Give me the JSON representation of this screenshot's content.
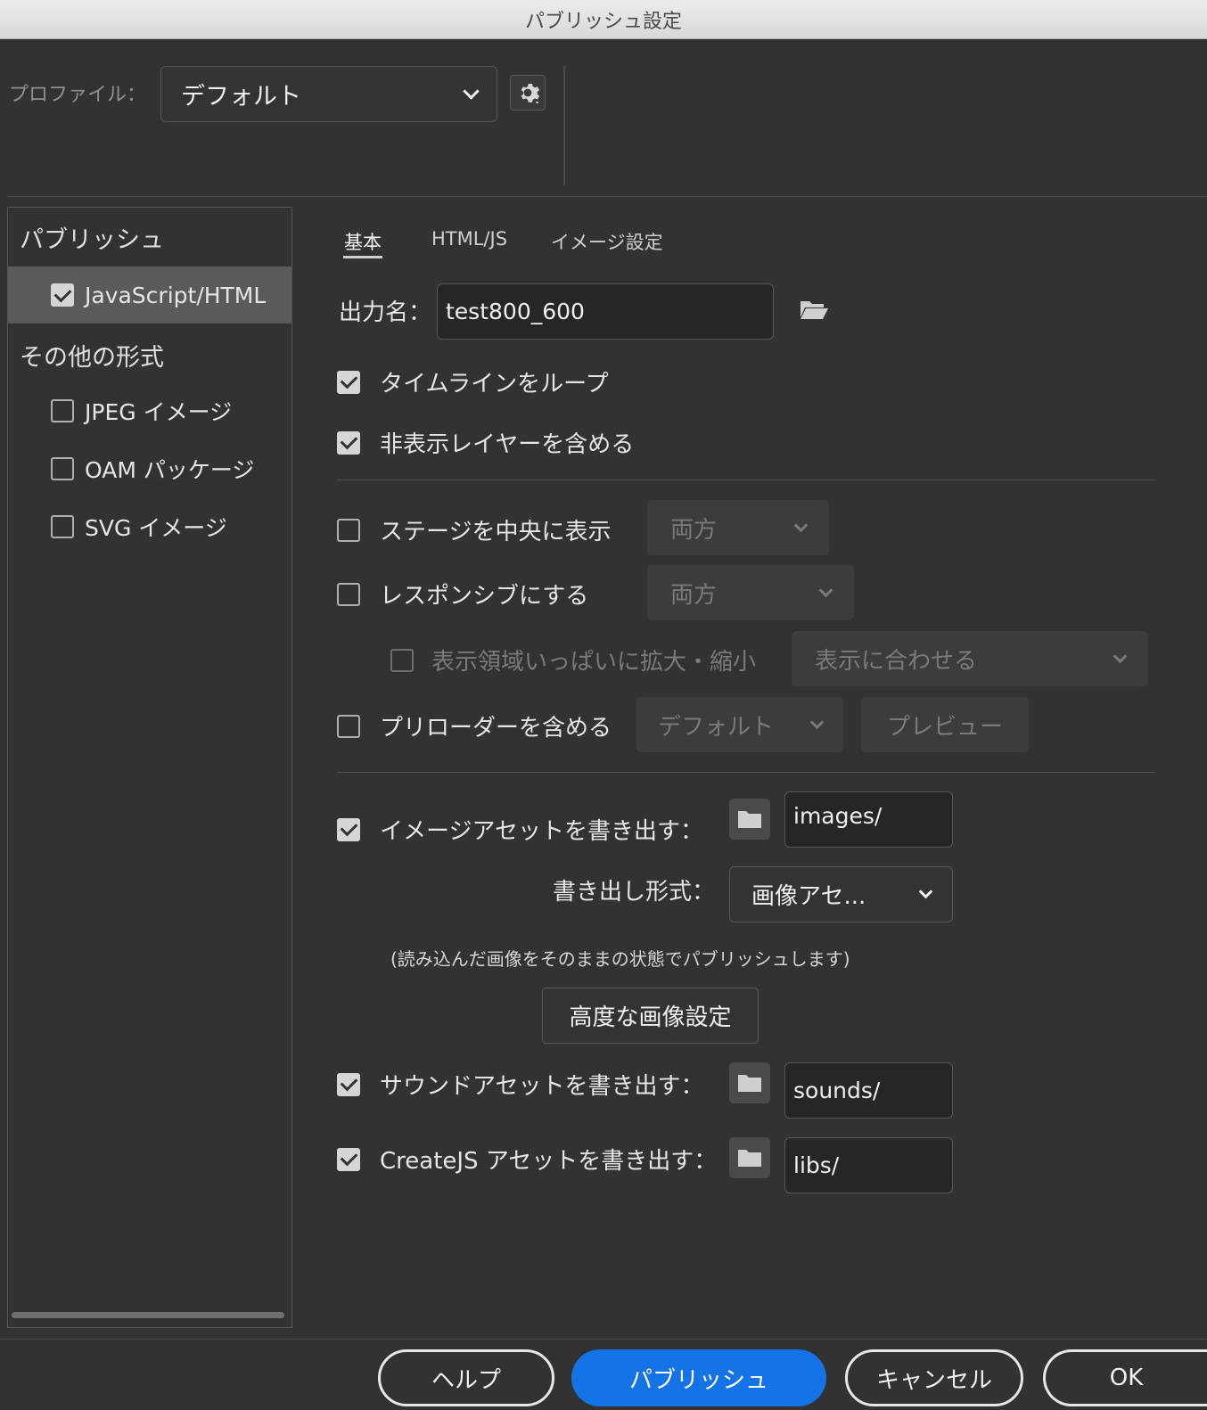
{
  "window": {
    "title": "パブリッシュ設定"
  },
  "profile": {
    "label": "プロファイル：",
    "value": "デフォルト"
  },
  "sidebar": {
    "publish_heading": "パブリッシュ",
    "publish_items": [
      {
        "label": "JavaScript/HTML",
        "checked": true
      }
    ],
    "other_heading": "その他の形式",
    "other_items": [
      {
        "label": "JPEG イメージ",
        "checked": false
      },
      {
        "label": "OAM パッケージ",
        "checked": false
      },
      {
        "label": "SVG イメージ",
        "checked": false
      }
    ]
  },
  "tabs": [
    {
      "label": "基本",
      "active": true
    },
    {
      "label": "HTML/JS",
      "active": false
    },
    {
      "label": "イメージ設定",
      "active": false
    }
  ],
  "output": {
    "label": "出力名：",
    "value": "test800_600"
  },
  "options": {
    "loop_timeline": {
      "label": "タイムラインをループ",
      "checked": true
    },
    "include_hidden_layers": {
      "label": "非表示レイヤーを含める",
      "checked": true
    },
    "center_stage": {
      "label": "ステージを中央に表示",
      "checked": false,
      "dropdown": "両方"
    },
    "responsive": {
      "label": "レスポンシブにする",
      "checked": false,
      "dropdown": "両方"
    },
    "scale_to_fill": {
      "label": "表示領域いっぱいに拡大・縮小",
      "checked": false,
      "dropdown": "表示に合わせる"
    },
    "include_preloader": {
      "label": "プリローダーを含める",
      "checked": false,
      "dropdown": "デフォルト",
      "preview_label": "プレビュー"
    }
  },
  "assets": {
    "images": {
      "label": "イメージアセットを書き出す：",
      "checked": true,
      "path": "images/"
    },
    "export_format": {
      "label": "書き出し形式：",
      "value": "画像アセ..."
    },
    "note": "(読み込んだ画像をそのままの状態でパブリッシュします)",
    "advanced_button": "高度な画像設定",
    "sounds": {
      "label": "サウンドアセットを書き出す：",
      "checked": true,
      "path": "sounds/"
    },
    "createjs": {
      "label": "CreateJS アセットを書き出す：",
      "checked": true,
      "path": "libs/"
    }
  },
  "footer": {
    "help": "ヘルプ",
    "publish": "パブリッシュ",
    "cancel": "キャンセル",
    "ok": "OK"
  },
  "colors": {
    "primary": "#1473e6",
    "background": "#323232"
  }
}
